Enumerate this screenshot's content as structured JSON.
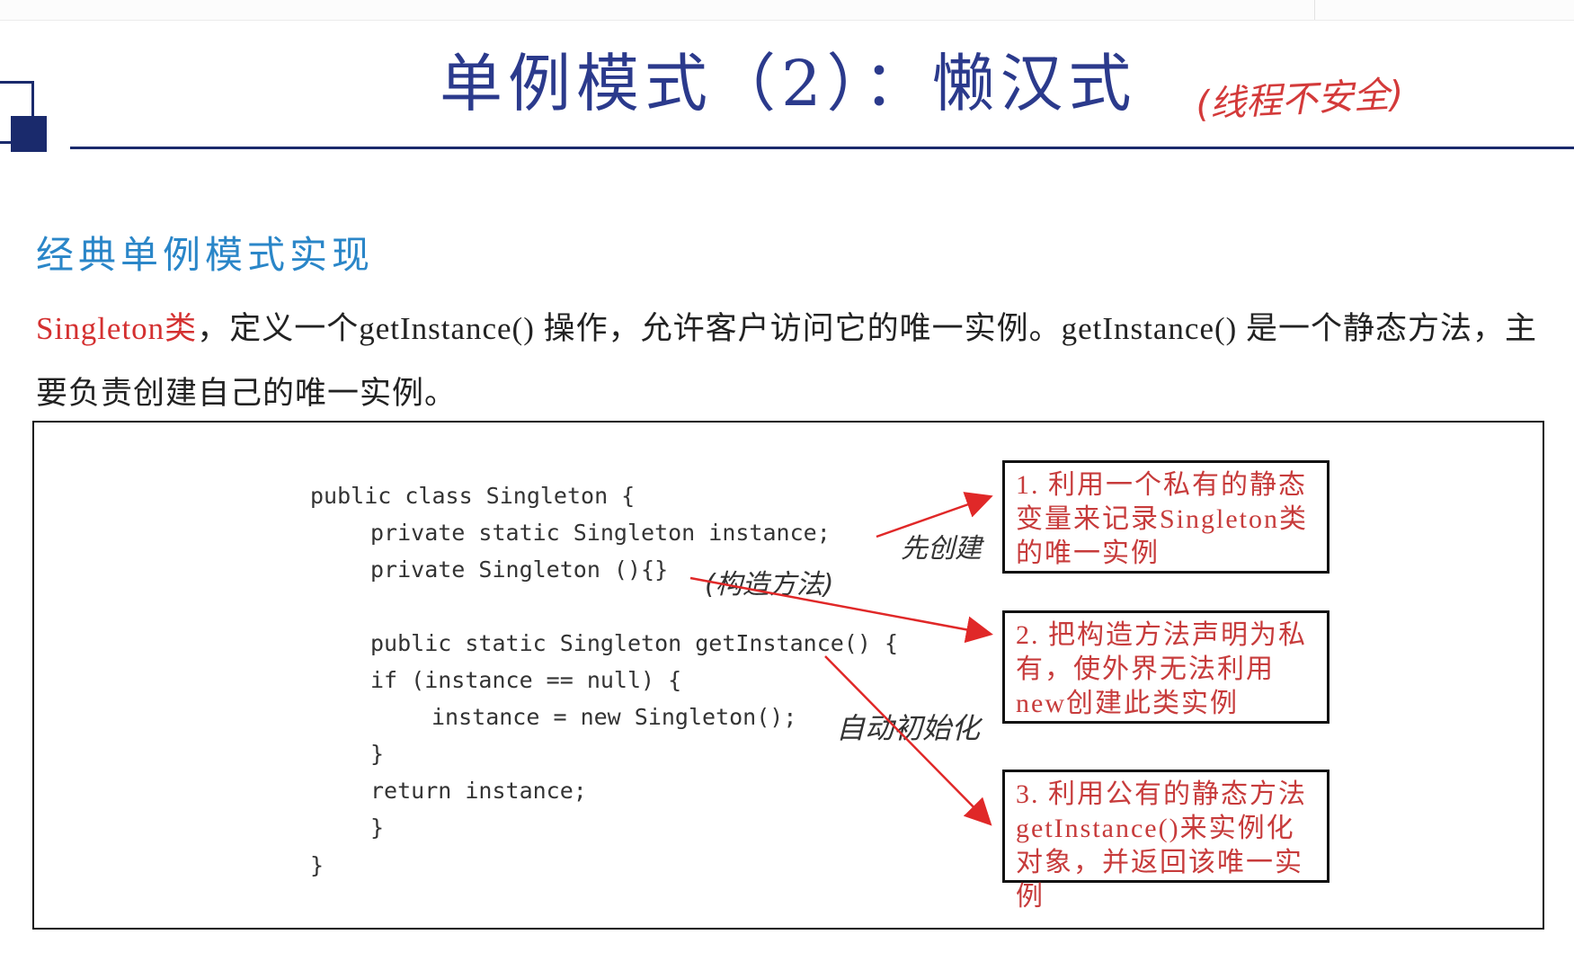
{
  "slide": {
    "title": "单例模式（2）：懒汉式",
    "title_note": "(线程不安全)",
    "subheading": "经典单例模式实现",
    "paragraph": {
      "highlight": "Singleton类",
      "text": "，定义一个getInstance() 操作，允许客户访问它的唯一实例。getInstance() 是一个静态方法，主要负责创建自己的唯一实例。"
    }
  },
  "code": {
    "line1": "public class Singleton {",
    "line2": "private static Singleton instance;",
    "line3": "private Singleton (){}",
    "line4": "public static Singleton getInstance() {",
    "line5": "if (instance == null) {",
    "line6": "instance = new Singleton();",
    "line7": "}",
    "line8": "return instance;",
    "line9": "}",
    "line10": "}"
  },
  "handwriting": {
    "note1": "先创建",
    "note2": "(构造方法)",
    "note3": "自动初始化"
  },
  "annotations": [
    {
      "text": "1. 利用一个私有的静态变量来记录Singleton类的唯一实例"
    },
    {
      "text": "2. 把构造方法声明为私有，使外界无法利用new创建此类实例"
    },
    {
      "text": "3. 利用公有的静态方法getInstance()来实例化对象，并返回该唯一实例"
    }
  ],
  "colors": {
    "title": "#2b3a8c",
    "rule": "#1a2a6c",
    "subheading": "#2a86c8",
    "accent_red": "#d43030",
    "arrow": "#e02828"
  }
}
